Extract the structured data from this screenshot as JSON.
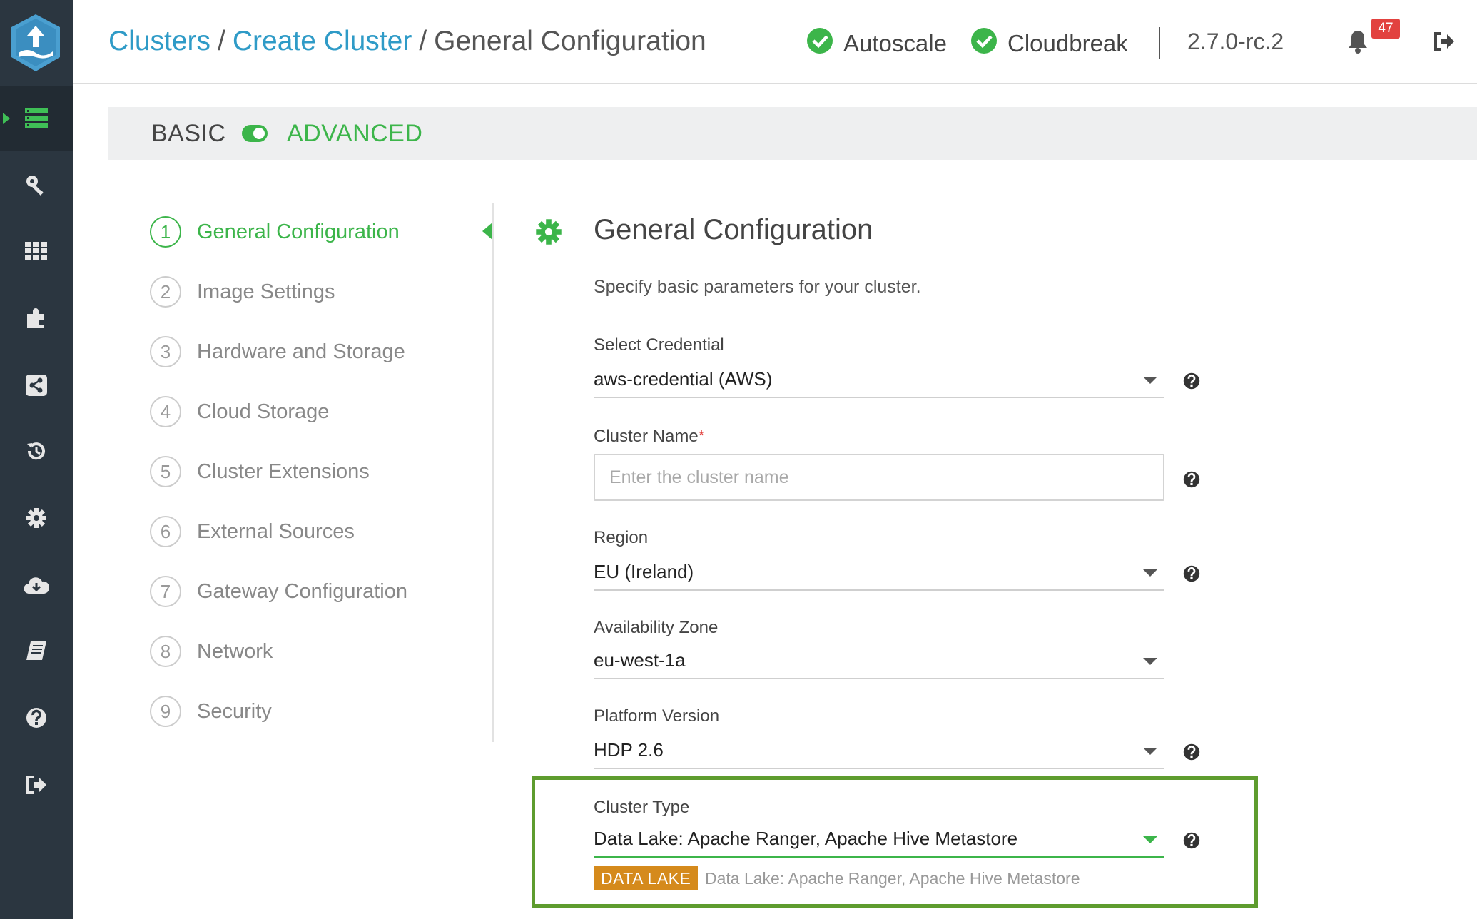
{
  "header": {
    "breadcrumb": [
      "Clusters",
      "Create Cluster",
      "General Configuration"
    ],
    "separator": "/",
    "services": [
      {
        "name": "Autoscale",
        "status": "ok"
      },
      {
        "name": "Cloudbreak",
        "status": "ok"
      }
    ],
    "version": "2.7.0-rc.2",
    "notification_count": "47"
  },
  "sidebar": {
    "icons": [
      "clusters-icon",
      "key-icon",
      "grid-icon",
      "puzzle-icon",
      "share-icon",
      "history-icon",
      "gear-icon",
      "cloud-download-icon",
      "book-icon",
      "help-icon",
      "logout-icon"
    ],
    "active": "clusters-icon"
  },
  "mode": {
    "basic_label": "BASIC",
    "advanced_label": "ADVANCED",
    "selected": "ADVANCED"
  },
  "steps": [
    {
      "num": "1",
      "label": "General Configuration",
      "active": true
    },
    {
      "num": "2",
      "label": "Image Settings"
    },
    {
      "num": "3",
      "label": "Hardware and Storage"
    },
    {
      "num": "4",
      "label": "Cloud Storage"
    },
    {
      "num": "5",
      "label": "Cluster Extensions"
    },
    {
      "num": "6",
      "label": "External Sources"
    },
    {
      "num": "7",
      "label": "Gateway Configuration"
    },
    {
      "num": "8",
      "label": "Network"
    },
    {
      "num": "9",
      "label": "Security"
    }
  ],
  "form": {
    "title": "General Configuration",
    "description": "Specify basic parameters for your cluster.",
    "credential": {
      "label": "Select Credential",
      "value": "aws-credential (AWS)"
    },
    "cluster_name": {
      "label": "Cluster Name",
      "required_mark": "*",
      "value": "",
      "placeholder": "Enter the cluster name"
    },
    "region": {
      "label": "Region",
      "value": "EU (Ireland)"
    },
    "availability_zone": {
      "label": "Availability Zone",
      "value": "eu-west-1a"
    },
    "platform_version": {
      "label": "Platform Version",
      "value": "HDP 2.6"
    },
    "cluster_type": {
      "label": "Cluster Type",
      "value": "Data Lake: Apache Ranger, Apache Hive Metastore",
      "tag": "DATA LAKE",
      "tag_description": "Data Lake: Apache Ranger, Apache Hive Metastore"
    }
  },
  "colors": {
    "accent_green": "#3cb54a",
    "link_blue": "#2f9bc7",
    "rail": "#2b3640",
    "badge_red": "#e2423f",
    "tag_orange": "#d58a1c",
    "highlight_border": "#5e9c2e"
  }
}
